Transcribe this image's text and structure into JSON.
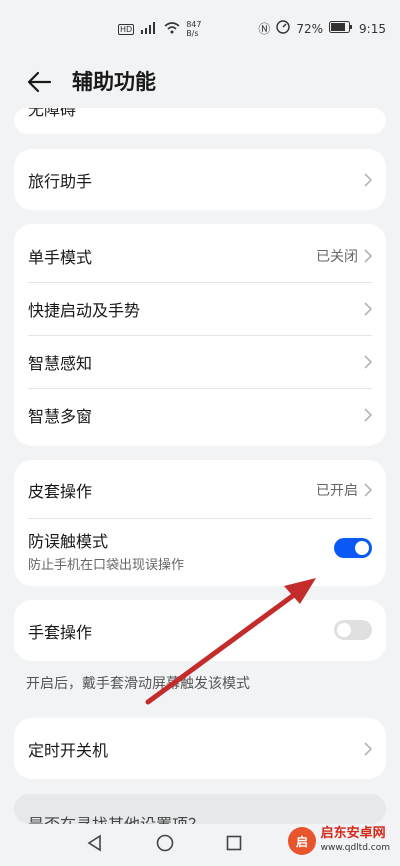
{
  "status": {
    "speed": "847",
    "speed_unit": "B/s",
    "battery": "72%",
    "time": "9:15"
  },
  "header": {
    "title": "辅助功能"
  },
  "cards": {
    "top_partial": {
      "label": "无障碍"
    },
    "travel": {
      "label": "旅行助手"
    },
    "one_hand": {
      "label": "单手模式",
      "value": "已关闭"
    },
    "shortcut": {
      "label": "快捷启动及手势"
    },
    "smart_sense": {
      "label": "智慧感知"
    },
    "multi_window": {
      "label": "智慧多窗"
    },
    "cover": {
      "label": "皮套操作",
      "value": "已开启"
    },
    "mistouch": {
      "label": "防误触模式",
      "sub": "防止手机在口袋出现误操作",
      "enabled": true
    },
    "glove": {
      "label": "手套操作",
      "enabled": false,
      "hint": "开启后，戴手套滑动屏幕触发该模式"
    },
    "timer": {
      "label": "定时开关机"
    },
    "bottom_partial": {
      "label": "是否在寻找其他设置项？"
    }
  },
  "colors": {
    "accent": "#0a59f7",
    "arrow": "#c42b2b",
    "toggle_off": "#e0e0e0"
  },
  "watermark": {
    "text": "启东安卓网",
    "url": "www.qdltd.com"
  }
}
